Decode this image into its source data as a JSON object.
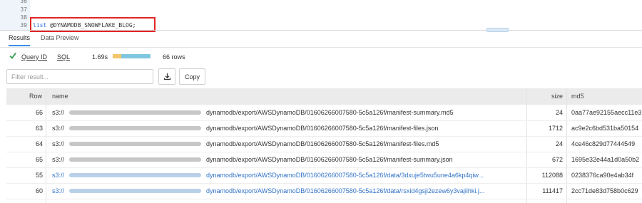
{
  "editor": {
    "line_numbers": [
      "36",
      "37",
      "38",
      "39"
    ],
    "code_keyword": "list",
    "code_rest": " @DYNAMODB_SNOWFLAKE_BLOG;"
  },
  "tabs": [
    {
      "label": "Results",
      "active": true
    },
    {
      "label": "Data Preview",
      "active": false
    }
  ],
  "status": {
    "query_id_label": "Query ID",
    "sql_label": "SQL",
    "duration": "1.69s",
    "progress_fraction": 0.22,
    "row_count": "66 rows"
  },
  "filter": {
    "placeholder": "Filter result..."
  },
  "toolbar": {
    "download_icon": "download-icon",
    "copy_label": "Copy"
  },
  "colors": {
    "accent": "#3a8ee6",
    "link": "#3173c6",
    "success": "#2e9b4f",
    "highlight_border": "#e02525"
  },
  "table": {
    "columns": [
      "Row",
      "name",
      "size",
      "md5"
    ],
    "rows": [
      {
        "row": "66",
        "prefix": "s3://",
        "path": "dynamodb/export/AWSDynamoDB/01606266007580-5c5a126f/manifest-summary.md5",
        "size": "24",
        "md5": "0aa77ae92155aecc11e3",
        "link": false
      },
      {
        "row": "63",
        "prefix": "s3://",
        "path": "dynamodb/export/AWSDynamoDB/01606266007580-5c5a126f/manifest-files.json",
        "size": "1712",
        "md5": "ac9e2c6bd531ba50154",
        "link": false
      },
      {
        "row": "64",
        "prefix": "s3://",
        "path": "dynamodb/export/AWSDynamoDB/01606266007580-5c5a126f/manifest-files.md5",
        "size": "24",
        "md5": "4ce46c829d77444549",
        "link": false
      },
      {
        "row": "65",
        "prefix": "s3://",
        "path": "dynamodb/export/AWSDynamoDB/01606266007580-5c5a126f/manifest-summary.json",
        "size": "672",
        "md5": "1695e32e44a1d0a50b2",
        "link": false
      },
      {
        "row": "55",
        "prefix": "s3://",
        "path": "dynamodb/export/AWSDynamoDB/01606266007580-5c5a126f/data/3dxuje5twu5une4a6kp4qiw...",
        "size": "112088",
        "md5": "0238376ca90e4ab34f",
        "link": true
      },
      {
        "row": "60",
        "prefix": "s3://",
        "path": "dynamodb/export/AWSDynamoDB/01606266007580-5c5a126f/data/rsxid4gsji2ezew6y3vajiihki.j...",
        "size": "111417",
        "md5": "2cc71de83d758b0c629",
        "link": true
      }
    ]
  }
}
